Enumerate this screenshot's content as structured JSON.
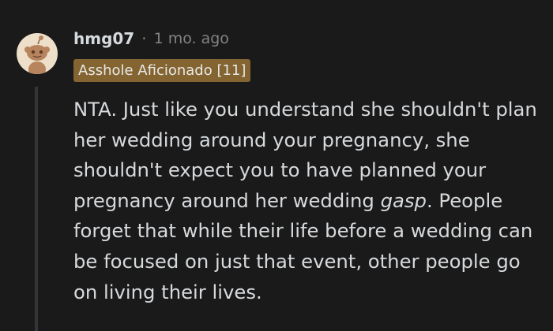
{
  "comment": {
    "author": "hmg07",
    "separator": "·",
    "timestamp": "1 mo. ago",
    "flair": "Asshole Aficionado [11]",
    "avatar_icon": "snoo-avatar-icon",
    "body": {
      "text_before": "NTA. Just like you understand she shouldn't plan her wedding around your pregnancy, she shouldn't expect you to have planned your pregnancy around her wedding ",
      "emphasis": "gasp",
      "text_after": ". People forget that while their life before a wedding can be focused on just that event, other people go on living their lives."
    }
  },
  "colors": {
    "background": "#1a1a1b",
    "text": "#d7dadc",
    "muted": "#818384",
    "flair_bg": "#846531",
    "avatar_bg": "#eddfc9",
    "thread_line": "#343536"
  }
}
